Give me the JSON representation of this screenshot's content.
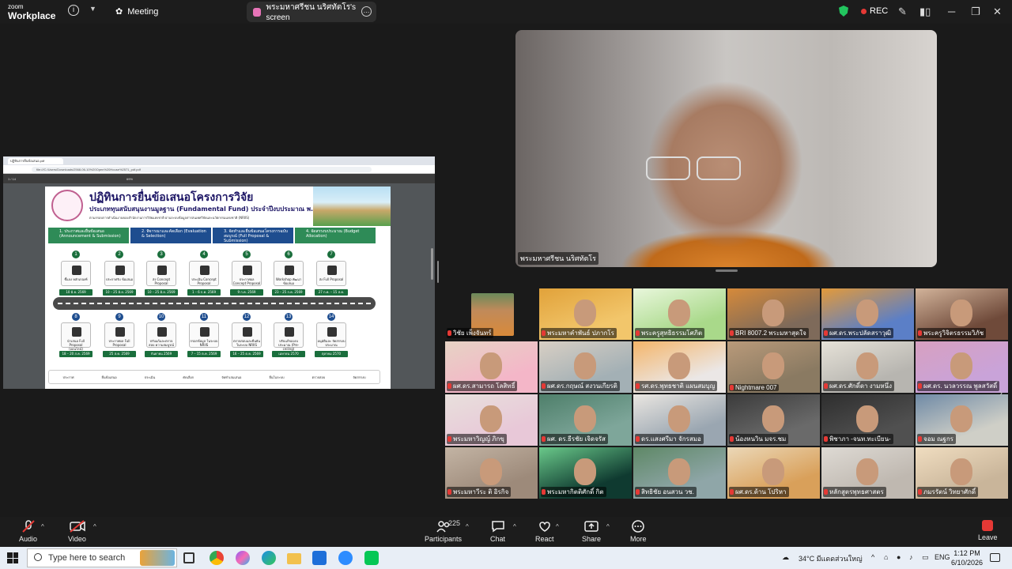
{
  "titlebar": {
    "logo_line1": "zoom",
    "logo_line2": "Workplace",
    "meeting_label": "Meeting",
    "screen_tab_label": "พระมหาศรีชน นริศทัตโร's screen",
    "rec_label": "REC"
  },
  "shared_screen": {
    "browser_tab": "ปฏิทินการยื่นข้อเสนอ.pdf",
    "url": "file:///C:/Users/Downloads/2568-06-10%20Open%20House%2571_pdf.pdf",
    "pdf_page": "1 / 14",
    "pdf_zoom": "69%",
    "title": "ปฏิทินการยื่นข้อเสนอโครงการวิจัย",
    "subtitle": "ประเภททุนสนับสนุนงานมูลฐาน (Fundamental Fund) ประจำปีงบประมาณ พ.ศ. 2571",
    "small_text": "ตามกรอบการดำเนินงานของสำนักงานการวิจัยแห่งชาติ ผ่านระบบข้อมูลสารสนเทศวิจัยและนวัตกรรมแห่งชาติ (NRIIS)",
    "phases": [
      {
        "label": "1. ประกาศและยื่นข้อเสนอ (Announcement & Submission)"
      },
      {
        "label": "2. พิจารณาและคัดเลือก (Evaluation & Selection)"
      },
      {
        "label": "3. จัดทำและยื่นข้อเสนอโครงการฉบับสมบูรณ์ (Full Proposal & Submission)"
      },
      {
        "label": "4. จัดสรรงบประมาณ (Budget Allocation)"
      }
    ],
    "top_steps": [
      {
        "num": "1",
        "label": "ชี้แจง หลักเกณฑ์",
        "date": "10 มิ.ย. 2569"
      },
      {
        "num": "2",
        "label": "ประกาศรับ ข้อเสนอ",
        "date": "10 – 25 มิ.ย. 2569"
      },
      {
        "num": "3",
        "label": "ส่ง Concept Proposal",
        "date": "10 – 25 มิ.ย. 2569"
      },
      {
        "num": "4",
        "label": "ประเมิน Concept Proposal",
        "date": "1 – 6 ก.ค. 2569"
      },
      {
        "num": "5",
        "label": "ประกาศผล Concept Proposal",
        "date": "9 ก.ค. 2569"
      },
      {
        "num": "6",
        "label": "Workshop พัฒนาข้อเสนอ",
        "date": "23 – 25 ก.ค. 2569"
      },
      {
        "num": "7",
        "label": "ส่ง Full Proposal",
        "date": "27 ก.ค. – 15 ส.ค. 2569"
      }
    ],
    "bottom_steps": [
      {
        "num": "8",
        "label": "นำเสนอ Full Proposal (ออนไลน์)",
        "date": "18 – 20 ส.ค. 2569"
      },
      {
        "num": "9",
        "label": "ประกาศผล Full Proposal",
        "date": "25 ส.ค. 2569"
      },
      {
        "num": "10",
        "label": "ปรับแก้และตรวจสอบ ความสมบูรณ์",
        "date": "กันยายน 2569"
      },
      {
        "num": "11",
        "label": "กรอกข้อมูล ในระบบ NRIIS",
        "date": "7 – 15 ต.ค. 2569"
      },
      {
        "num": "12",
        "label": "ตรวจสอบและยืนยัน ในระบบ NRIIS",
        "date": "16 – 25 ต.ค. 2569"
      },
      {
        "num": "13",
        "label": "ปรับแก้ของงบประมาณ (Pre-ceiling)",
        "date": "เมษายน 2570"
      },
      {
        "num": "14",
        "label": "อนุมัติและ จัดสรรงบประมาณ",
        "date": "ตุลาคม 2570"
      }
    ],
    "legend": [
      "ประกาศ",
      "ยื่นข้อเสนอ",
      "ประเมิน",
      "คัดเลือก",
      "จัดทำเล่มเสนอ",
      "ยื่นในระบบ",
      "ตรวจสอบ",
      "จัดสรรงบ"
    ]
  },
  "speaker": {
    "name": "พระมหาศรีชน นริศทัตโร"
  },
  "gallery": [
    {
      "name": "วิชัย เพ็งจันทร์",
      "bg": "#1c1c1c",
      "accent": "#d98a3a"
    },
    {
      "name": "พระมหาคำพันธ์ ปภากโร",
      "bg": "#f2c66b",
      "accent": "#e1a23a"
    },
    {
      "name": "พระครูสุทธิธรรมโศภิต",
      "bg": "#a9d98a",
      "accent": "#e9f7dc"
    },
    {
      "name": "BRI 8007.2 พระมหาสุดใจ",
      "bg": "#7e6a5a",
      "accent": "#d68a3a"
    },
    {
      "name": "ผศ.ดร.พระปลัดสราวุฒิ",
      "bg": "#5b7fc7",
      "accent": "#e39a3a"
    },
    {
      "name": "พระครูวิจิตรธรรมวิภัช",
      "bg": "#6f4a3a",
      "accent": "#d2b39a"
    },
    {
      "name": "ผศ.ดร.สามารถ โลสิทธิ์",
      "bg": "#f4b6c8",
      "accent": "#e6d3c4"
    },
    {
      "name": "ผศ.ดร.กฤษณ์ สงวนเกียรติ",
      "bg": "#a3b0b5",
      "accent": "#d8cfc4"
    },
    {
      "name": "รศ.ดร.พุทธชาติ แผนสมบุญ",
      "bg": "#ebe7e6",
      "accent": "#f4b56a"
    },
    {
      "name": "Nightmare 007",
      "bg": "#8a7a62",
      "accent": "#b99a7a"
    },
    {
      "name": "ผศ.ดร.ศักดิ์ดา งามหนึ่ง",
      "bg": "#b7b5b0",
      "accent": "#e6e2d8"
    },
    {
      "name": "ผศ.ดร. นวลวรรณ พูลสวัสดิ์",
      "bg": "#c9a3d9",
      "accent": "#d7a0c0"
    },
    {
      "name": "พระมหาวิญญ์ ภิกขุ",
      "bg": "#e8c8d8",
      "accent": "#e8e0dc"
    },
    {
      "name": "ผศ. ดร.ธีรชัย เจิดจรัส",
      "bg": "#7ea69a",
      "accent": "#4e7f6a"
    },
    {
      "name": "ดร.แสงศรีมา จักรสมอ",
      "bg": "#9aa6b1",
      "accent": "#eae6e1"
    },
    {
      "name": "น้องหนวิน มจร.ชม",
      "bg": "#6a6a6a",
      "accent": "#3b3b3b"
    },
    {
      "name": "พิชาภา -จนท.ทะเบียน-",
      "bg": "#505050",
      "accent": "#2e2e2e"
    },
    {
      "name": "จอม ณฐกร",
      "bg": "#cfcfc7",
      "accent": "#6f8aa6"
    },
    {
      "name": "พระมหาวีระ ติ อิรกิจ",
      "bg": "#9d8a7a",
      "accent": "#c3b4a4"
    },
    {
      "name": "พระมหากิตติศักดิ์ กิต",
      "bg": "#0f3a30",
      "accent": "#6ac98a"
    },
    {
      "name": "สิทธิชัย อนสวน วช.",
      "bg": "#8fa6a8",
      "accent": "#5e8866"
    },
    {
      "name": "ผศ.ดร.ด้าน โปริหา",
      "bg": "#d9a05a",
      "accent": "#ebd8b8"
    },
    {
      "name": "หลักสูตรพุทธศาสตร",
      "bg": "#bfb8b0",
      "accent": "#dedad4"
    },
    {
      "name": "ภมรรัตน์ วิทยาศักดิ์",
      "bg": "#c9b59a",
      "accent": "#f0ddc0"
    }
  ],
  "toolbar": {
    "audio": "Audio",
    "video": "Video",
    "participants": "Participants",
    "participants_count": "225",
    "chat": "Chat",
    "react": "React",
    "share": "Share",
    "more": "More",
    "leave": "Leave"
  },
  "taskbar": {
    "search_placeholder": "Type here to search",
    "weather": "34°C  มีแดดส่วนใหญ่",
    "lang": "ENG",
    "time": "1:12 PM",
    "date": "6/10/2026"
  }
}
